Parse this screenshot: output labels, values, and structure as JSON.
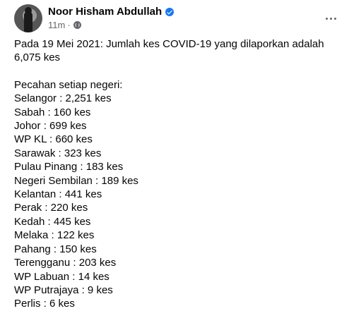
{
  "post": {
    "author": "Noor Hisham Abdullah",
    "timestamp": "11m",
    "separator": "·",
    "intro": "Pada 19 Mei 2021: Jumlah kes COVID-19 yang dilaporkan adalah 6,075 kes",
    "breakdown_heading": "Pecahan setiap negeri:",
    "states": [
      "Selangor : 2,251 kes",
      "Sabah : 160 kes",
      "Johor : 699 kes",
      "WP KL : 660 kes",
      "Sarawak : 323 kes",
      "Pulau Pinang : 183 kes",
      "Negeri Sembilan : 189 kes",
      "Kelantan : 441 kes",
      "Perak : 220 kes",
      "Kedah : 445 kes",
      "Melaka : 122 kes",
      "Pahang : 150 kes",
      "Terengganu : 203 kes",
      "WP Labuan : 14 kes",
      "WP Putrajaya : 9 kes",
      "Perlis : 6 kes"
    ]
  },
  "icons": {
    "verified": "verified-badge-icon",
    "privacy": "globe-icon",
    "menu": "more-options-icon"
  },
  "colors": {
    "verified_blue": "#1877f2",
    "secondary_text": "#65676b",
    "primary_text": "#050505"
  }
}
